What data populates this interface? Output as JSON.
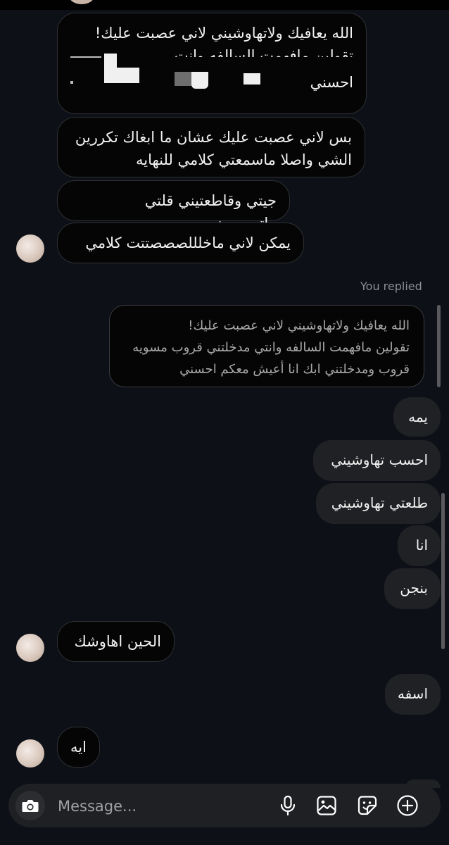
{
  "messages_received": {
    "m1_line1": "الله يعافيك ولاتهاوشيني لاني عصبت عليك!",
    "m1_line2": "تقولين مافهمت السالفه وانت",
    "m1_line3": "احسني",
    "m2": "بس لاني عصبت عليك عشان ما ابغاك تكررين\nالشي واصلا ماسمعتي كلامي للنهايه",
    "m3": "جيتي وقاطعتيني قلتي ماتسميعيني",
    "m4": "يمكن لاني ماخلللصصصتتت كلامي",
    "m5": "الحين اهاوشك",
    "m6": "ايه"
  },
  "reply_label": "You replied",
  "quoted_message": "الله يعافيك ولاتهاوشيني لاني عصبت عليك!\nتقولين مافهمت السالفه وانتي مدخلتني قروب مسويه\nقروب ومدخلتني ابك انا أعيش معكم احسني",
  "messages_sent": {
    "s1": "يمه",
    "s2": "احسب تهاوشيني",
    "s3": "طلعتي تهاوشيني",
    "s4": "انا",
    "s5": "بنجن",
    "s6": "اسفه"
  },
  "composer": {
    "placeholder": "Message...",
    "icons": [
      "camera-icon",
      "microphone-icon",
      "gallery-icon",
      "sticker-icon",
      "add-icon"
    ]
  },
  "colors": {
    "background": "#0d1117",
    "received_bubble": "#050505",
    "sent_bubble": "#202124",
    "muted_text": "#8e8e93"
  }
}
